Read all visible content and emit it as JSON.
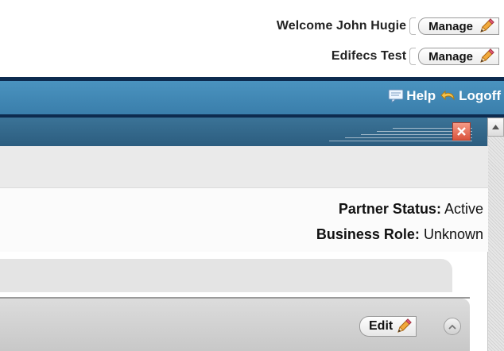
{
  "user": {
    "welcome_text": "Welcome John Hugie",
    "manage_label": "Manage",
    "org_name": "Edifecs Test",
    "org_manage_label": "Manage"
  },
  "nav": {
    "help_label": "Help",
    "logoff_label": "Logoff"
  },
  "partner": {
    "status_label": "Partner Status:",
    "status_value": "Active",
    "role_label": "Business Role:",
    "role_value": "Unknown"
  },
  "section": {
    "edit_label": "Edit"
  },
  "icons": {
    "manage": "pencil-icon",
    "help": "help-chat-icon",
    "logoff": "logoff-arrow-icon",
    "close": "close-icon",
    "scroll_up": "scroll-up-arrow-icon",
    "collapse": "collapse-chevron-icon"
  },
  "colors": {
    "accent_bar": "#3a7eab",
    "navy": "#0d2b4f",
    "window_header": "#2c5d7f",
    "close_button": "#d9533c"
  }
}
